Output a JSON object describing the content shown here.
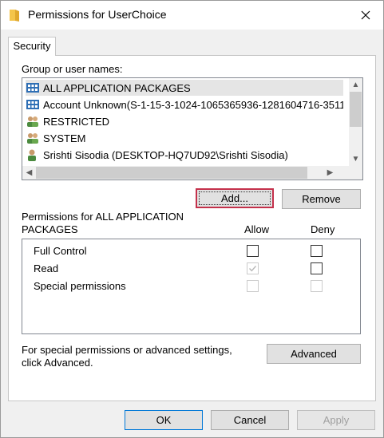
{
  "window": {
    "title": "Permissions for UserChoice",
    "close_icon": "close-icon"
  },
  "tabs": [
    {
      "label": "Security",
      "active": true
    }
  ],
  "group": {
    "heading": "Group or user names:",
    "items": [
      {
        "label": "ALL APPLICATION PACKAGES",
        "icon": "package-group-icon",
        "selected": true
      },
      {
        "label": "Account Unknown(S-1-15-3-1024-1065365936-1281604716-35117",
        "icon": "unknown-account-icon",
        "selected": false
      },
      {
        "label": "RESTRICTED",
        "icon": "users-group-icon",
        "selected": false
      },
      {
        "label": "SYSTEM",
        "icon": "users-group-icon",
        "selected": false
      },
      {
        "label": "Srishti Sisodia (DESKTOP-HQ7UD92\\Srishti Sisodia)",
        "icon": "user-icon",
        "selected": false
      }
    ]
  },
  "buttons": {
    "add": "Add...",
    "remove": "Remove",
    "advanced": "Advanced",
    "ok": "OK",
    "cancel": "Cancel",
    "apply": "Apply"
  },
  "permissions": {
    "heading_line1": "Permissions for ALL APPLICATION",
    "heading_line2": "PACKAGES",
    "allow_header": "Allow",
    "deny_header": "Deny",
    "rows": [
      {
        "label": "Full Control",
        "allow": false,
        "allow_disabled": false,
        "deny": false,
        "deny_disabled": false
      },
      {
        "label": "Read",
        "allow": true,
        "allow_disabled": true,
        "deny": false,
        "deny_disabled": false
      },
      {
        "label": "Special permissions",
        "allow": false,
        "allow_disabled": true,
        "deny": false,
        "deny_disabled": true
      }
    ]
  },
  "advanced_note": {
    "line1": "For special permissions or advanced settings,",
    "line2": "click Advanced."
  },
  "colors": {
    "focus_border": "#c4314b",
    "selection": "#e5e5e5"
  }
}
